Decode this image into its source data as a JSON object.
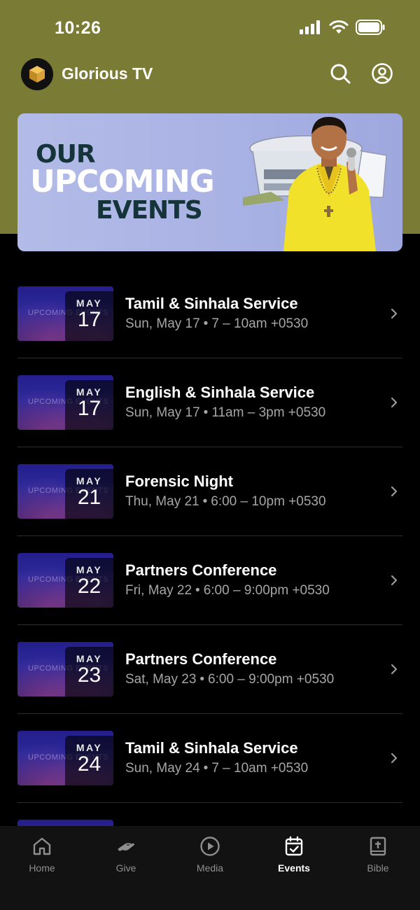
{
  "status_bar": {
    "time": "10:26"
  },
  "header": {
    "title": "Glorious TV"
  },
  "banner": {
    "line1": "OUR",
    "line2": "UPCOMING",
    "line3": "EVENTS"
  },
  "thumb_text": "UPCOMING EVENTS",
  "events": [
    {
      "month": "MAY",
      "day": "17",
      "title": "Tamil & Sinhala Service",
      "date": "Sun, May 17",
      "time": "7 – 10am +0530"
    },
    {
      "month": "MAY",
      "day": "17",
      "title": "English & Sinhala Service",
      "date": "Sun, May 17",
      "time": "11am – 3pm +0530"
    },
    {
      "month": "MAY",
      "day": "21",
      "title": "Forensic Night",
      "date": "Thu, May 21",
      "time": "6:00 – 10pm +0530"
    },
    {
      "month": "MAY",
      "day": "22",
      "title": "Partners Conference",
      "date": "Fri, May 22",
      "time": "6:00 – 9:00pm +0530"
    },
    {
      "month": "MAY",
      "day": "23",
      "title": "Partners Conference",
      "date": "Sat, May 23",
      "time": "6:00 – 9:00pm +0530"
    },
    {
      "month": "MAY",
      "day": "24",
      "title": "Tamil & Sinhala Service",
      "date": "Sun, May 24",
      "time": "7 – 10am +0530"
    }
  ],
  "tabs": [
    {
      "label": "Home",
      "icon": "home-icon"
    },
    {
      "label": "Give",
      "icon": "give-icon"
    },
    {
      "label": "Media",
      "icon": "play-icon"
    },
    {
      "label": "Events",
      "icon": "calendar-icon",
      "active": true
    },
    {
      "label": "Bible",
      "icon": "bible-icon"
    }
  ],
  "colors": {
    "header_bg": "#7a7b35",
    "banner_bg": "#a9b2e4",
    "active_tab": "#ffffff",
    "inactive_tab": "#8e8e8e"
  }
}
